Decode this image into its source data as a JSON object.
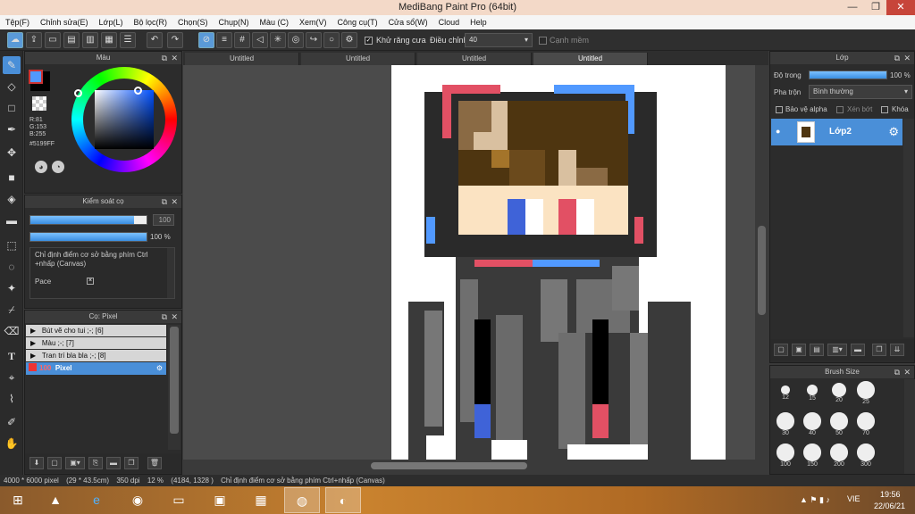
{
  "window": {
    "title": "MediBang Paint Pro (64bit)",
    "min": "—",
    "max": "❐",
    "close": "✕"
  },
  "menu": [
    "Tệp(F)",
    "Chỉnh sửa(E)",
    "Lớp(L)",
    "Bộ lọc(R)",
    "Chọn(S)",
    "Chụp(N)",
    "Màu (C)",
    "Xem(V)",
    "Công cụ(T)",
    "Cửa sổ(W)",
    "Cloud",
    "Help"
  ],
  "toolbar": {
    "antialias_label": "Khử răng cưa",
    "correction_label": "Điều chỉnh",
    "correction_value": "40",
    "soft_edge_label": "Cạnh mềm"
  },
  "tabs": [
    "Untitled",
    "Untitled",
    "Untitled",
    "Untitled"
  ],
  "color_panel": {
    "title": "Màu",
    "r": "R:81",
    "g": "G:153",
    "b": "B:255",
    "hex": "#5199FF",
    "fg": "#5199ff",
    "bg": "#000000"
  },
  "brush_control": {
    "title": "Kiểm soát cọ",
    "size": "100",
    "opacity": "100 %",
    "hint": "Chỉ định điểm cơ sở bằng phím Ctrl +nhấp (Canvas)",
    "pace_label": "Pace"
  },
  "brush_panel": {
    "title": "Cọ: Pixel",
    "groups": [
      "Bút vẽ cho tui ;-; [6]",
      "Màu ;-; [7]",
      "Tran trí bla bla ;-; [8]"
    ],
    "selected_size": "100",
    "selected_name": "Pixel"
  },
  "layer_panel": {
    "title": "Lớp",
    "opacity_label": "Độ trong",
    "opacity_value": "100 %",
    "blend_label": "Pha trộn",
    "blend_value": "Bình thường",
    "protect_alpha": "Bảo vệ alpha",
    "clipping": "Xén bớt",
    "lock": "Khóa",
    "layer_name": "Lớp2"
  },
  "brush_size": {
    "title": "Brush Size",
    "sizes": [
      "12",
      "15",
      "20",
      "25",
      "30",
      "40",
      "50",
      "70",
      "100",
      "150",
      "200",
      "300"
    ]
  },
  "status": {
    "dims": "4000 * 6000 pixel",
    "cm": "(29 * 43.5cm)",
    "dpi": "350 dpi",
    "zoom": "12 %",
    "coords": "(4184, 1328 )",
    "hint": "Chỉ định điểm cơ sở bằng phím Ctrl+nhấp (Canvas)"
  },
  "taskbar": {
    "lang": "VIE",
    "time": "19:56",
    "date": "22/06/21"
  }
}
